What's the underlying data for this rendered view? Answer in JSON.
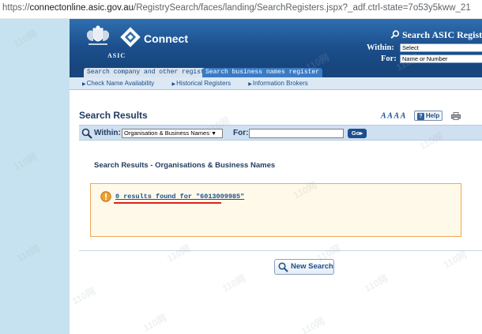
{
  "browser": {
    "url_prefix": "https://",
    "url_host": "connectonline.asic.gov.au",
    "url_path": "/RegistrySearch/faces/landing/SearchRegisters.jspx?_adf.ctrl-state=7o53y5kww_21"
  },
  "banner": {
    "agency_label": "ASIC",
    "app_name": "Connect",
    "search_title": "Search ASIC Registers",
    "within_label": "Within:",
    "within_value": "Select",
    "for_label": "For:",
    "for_placeholder": "Name or Number"
  },
  "tabs": [
    {
      "label": "Search company and other registers"
    },
    {
      "label": "Search business names register"
    }
  ],
  "subnav": [
    {
      "label": "Check Name Availability"
    },
    {
      "label": "Historical Registers"
    },
    {
      "label": "Information Brokers"
    }
  ],
  "page": {
    "title": "Search Results",
    "font_size_control": "A A A A",
    "help_label": "Help"
  },
  "search_bar": {
    "within_label": "Within:",
    "within_value": "Organisation & Business Names",
    "for_label": "For:",
    "for_value": "",
    "go_label": "Go"
  },
  "results": {
    "heading": "Search Results - Organisations & Business Names",
    "message": "0 results found for \"6013009985\""
  },
  "actions": {
    "new_search_label": "New Search"
  },
  "watermark_text": "110网",
  "colors": {
    "brand_blue": "#1c4f8c",
    "sidebar_blue": "#c6e2f0",
    "notice_border": "#f0a65a",
    "warning_orange": "#f0a030",
    "underline_red": "#e02020"
  }
}
